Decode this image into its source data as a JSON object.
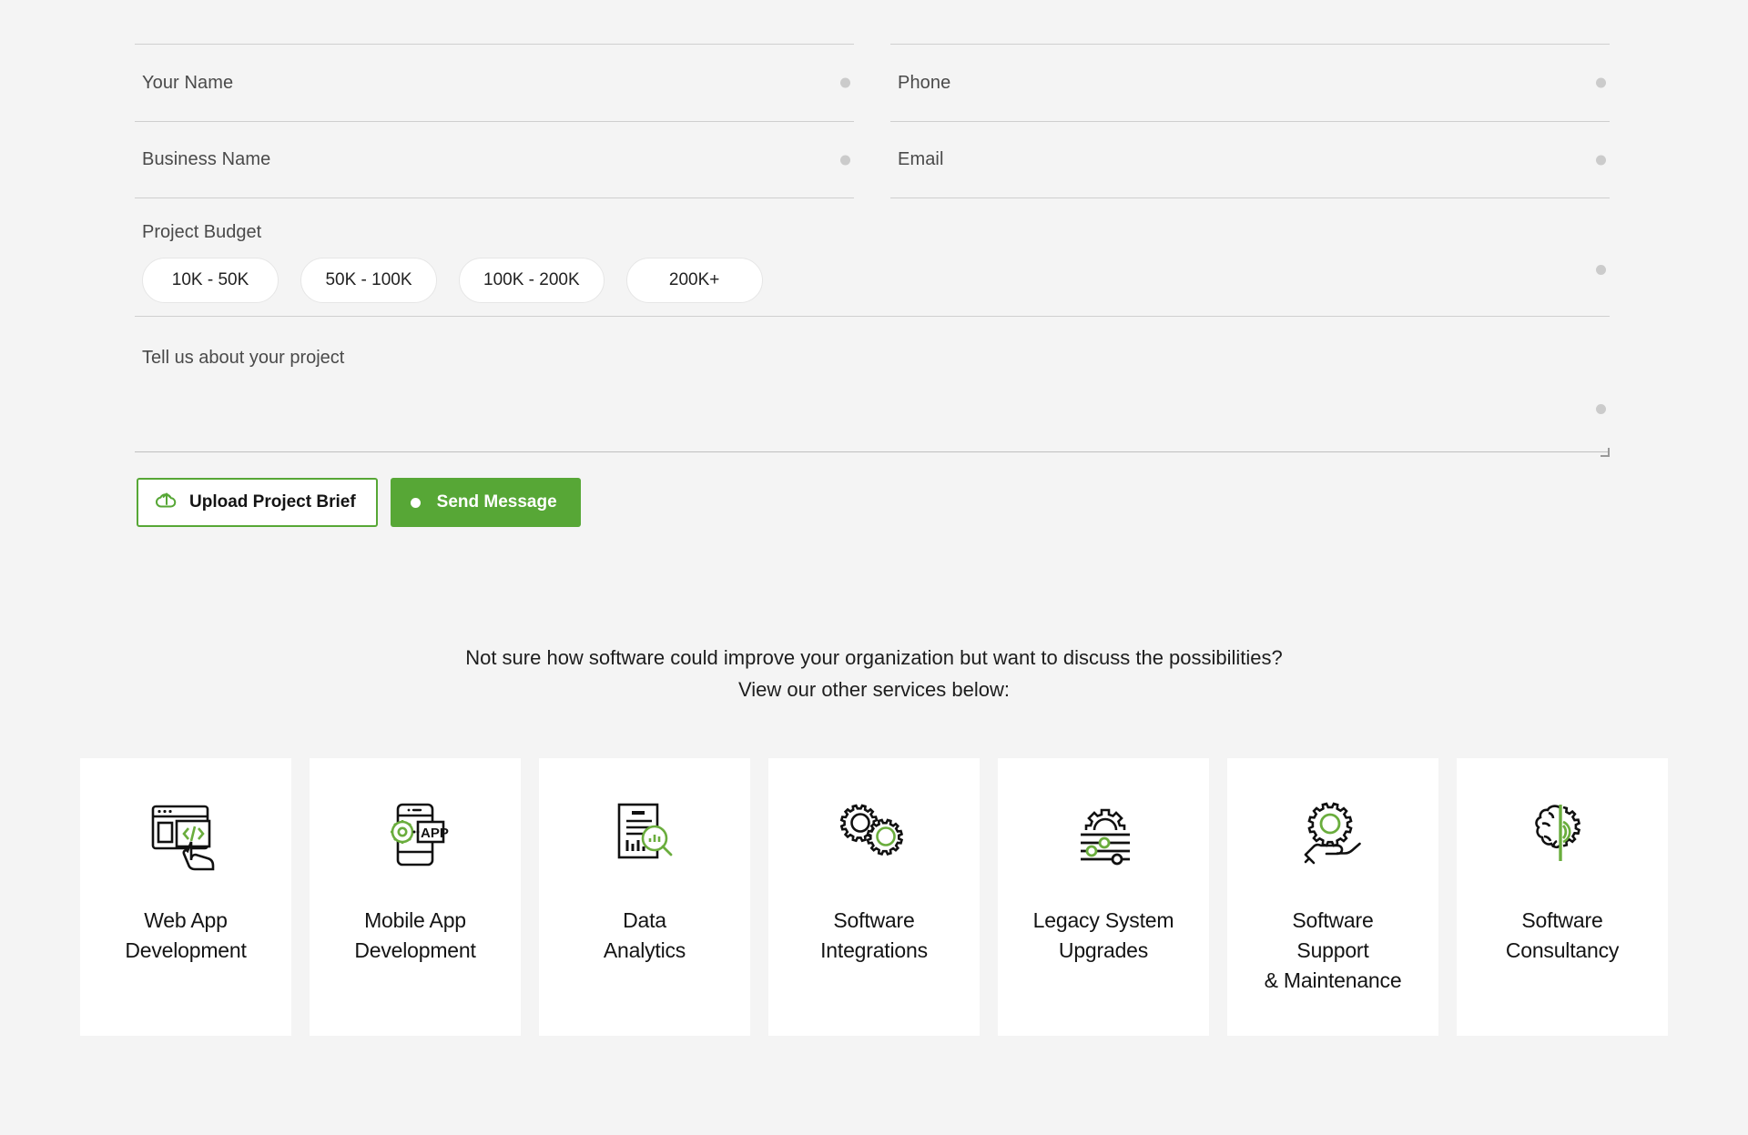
{
  "theme": {
    "background": "#f4f4f4",
    "accent_green": "#57a736",
    "card_background": "#ffffff",
    "text": "#1d1d1d",
    "placeholder": "#4a4a4a",
    "rule": "#cfcfcf"
  },
  "form": {
    "fields": [
      {
        "name": "your-name",
        "label": "Your Name",
        "value": ""
      },
      {
        "name": "phone",
        "label": "Phone",
        "value": ""
      },
      {
        "name": "business-name",
        "label": "Business Name",
        "value": ""
      },
      {
        "name": "email",
        "label": "Email",
        "value": ""
      }
    ],
    "budget": {
      "label": "Project Budget",
      "options": [
        "10K - 50K",
        "50K - 100K",
        "100K - 200K",
        "200K+"
      ],
      "selected": ""
    },
    "message": {
      "label": "Tell us about your project",
      "value": ""
    },
    "buttons": {
      "upload": "Upload Project Brief",
      "send": "Send Message"
    }
  },
  "prompt": {
    "line1": "Not sure how software could improve your organization but want to discuss the possibilities?",
    "line2": "View our other services below:"
  },
  "services": [
    {
      "icon": "web-app-development-icon",
      "title": "Web App\nDevelopment"
    },
    {
      "icon": "mobile-app-development-icon",
      "title": "Mobile App\nDevelopment"
    },
    {
      "icon": "data-analytics-icon",
      "title": "Data\nAnalytics"
    },
    {
      "icon": "software-integrations-icon",
      "title": "Software\nIntegrations"
    },
    {
      "icon": "legacy-system-upgrades-icon",
      "title": "Legacy System\nUpgrades"
    },
    {
      "icon": "software-support-maintenance-icon",
      "title": "Software\nSupport\n& Maintenance"
    },
    {
      "icon": "software-consultancy-icon",
      "title": "Software\nConsultancy"
    }
  ]
}
